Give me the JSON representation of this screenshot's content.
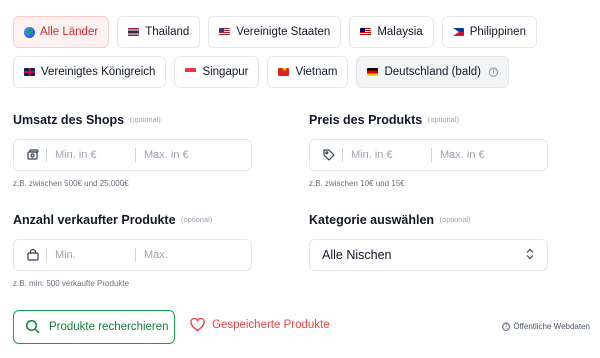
{
  "countries": [
    {
      "label": "Alle Länder",
      "icon": "globe-icon",
      "state": "active"
    },
    {
      "label": "Thailand",
      "icon": "flag-th-icon"
    },
    {
      "label": "Vereinigte Staaten",
      "icon": "flag-us-icon"
    },
    {
      "label": "Malaysia",
      "icon": "flag-my-icon"
    },
    {
      "label": "Philippinen",
      "icon": "flag-ph-icon"
    },
    {
      "label": "Vereinigtes Königreich",
      "icon": "flag-gb-icon"
    },
    {
      "label": "Singapur",
      "icon": "flag-sg-icon"
    },
    {
      "label": "Vietnam",
      "icon": "flag-vn-icon"
    },
    {
      "label": "Deutschland (bald)",
      "icon": "flag-de-icon",
      "state": "disabled",
      "info": "ⓘ"
    }
  ],
  "shop_revenue": {
    "label": "Umsatz des Shops",
    "optional": "(optional)",
    "min_placeholder": "Min. in €",
    "max_placeholder": "Max. in €",
    "hint": "z.B. zwischen 500€ und 25.000€",
    "icon": "money-icon"
  },
  "product_price": {
    "label": "Preis des Produkts",
    "optional": "(optional)",
    "min_placeholder": "Min. in €",
    "max_placeholder": "Max. in €",
    "hint": "z.B. zwischen 10€ und 15€",
    "icon": "tag-icon"
  },
  "products_sold": {
    "label": "Anzahl verkaufter Produkte",
    "optional": "(optional)",
    "min_placeholder": "Min.",
    "max_placeholder": "Max.",
    "hint": "z.B. min. 500 verkaufte Produkte",
    "icon": "shopping-bag-icon"
  },
  "category": {
    "label": "Kategorie auswählen",
    "optional": "(optional)",
    "selected": "Alle Nischen"
  },
  "actions": {
    "search_label": "Produkte recherchieren",
    "saved_label": "Gespeicherte Produkte",
    "public_data": "Öffentliche Webdaten",
    "public_info": "ⓘ"
  },
  "colors": {
    "accent_red": "#dc2626",
    "accent_green": "#16a34a"
  }
}
